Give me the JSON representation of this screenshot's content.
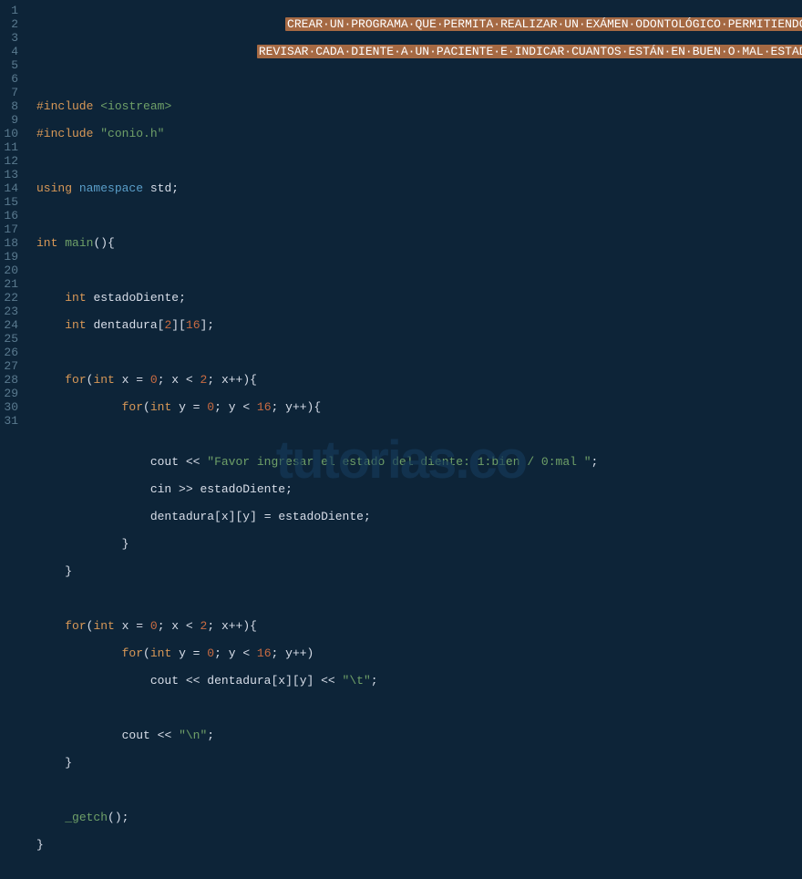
{
  "lineNumbers": [
    "1",
    "2",
    "3",
    "4",
    "5",
    "6",
    "7",
    "8",
    "9",
    "10",
    "11",
    "12",
    "13",
    "14",
    "15",
    "16",
    "17",
    "18",
    "19",
    "20",
    "21",
    "22",
    "23",
    "24",
    "25",
    "26",
    "27",
    "28",
    "29",
    "30",
    "31"
  ],
  "code": {
    "comment1": "CREAR·UN·PROGRAMA·QUE·PERMITA·REALIZAR·UN·EXÁMEN·ODONTOLÓGICO·PERMITIENDO",
    "comment2": "REVISAR·CADA·DIENTE·A·UN·PACIENTE·E·INDICAR·CUANTOS·ESTÁN·EN·BUEN·O·MAL·ESTADO",
    "include1_pre": "#include",
    "include1_path": "<iostream>",
    "include2_pre": "#include",
    "include2_path": "\"conio.h\"",
    "using": "using",
    "namespace": "namespace",
    "std": "std",
    "int": "int",
    "main": "main",
    "estadoDiente": "estadoDiente",
    "dentadura": "dentadura",
    "two": "2",
    "sixteen": "16",
    "zero": "0",
    "for": "for",
    "x": "x",
    "y": "y",
    "cout": "cout",
    "cin": "cin",
    "prompt": "\"Favor ingresar el estado del diente: 1:bien / 0:mal \"",
    "tab": "\"\\t\"",
    "nl": "\"\\n\"",
    "getch": "_getch"
  },
  "watermark": "tutorias.co"
}
